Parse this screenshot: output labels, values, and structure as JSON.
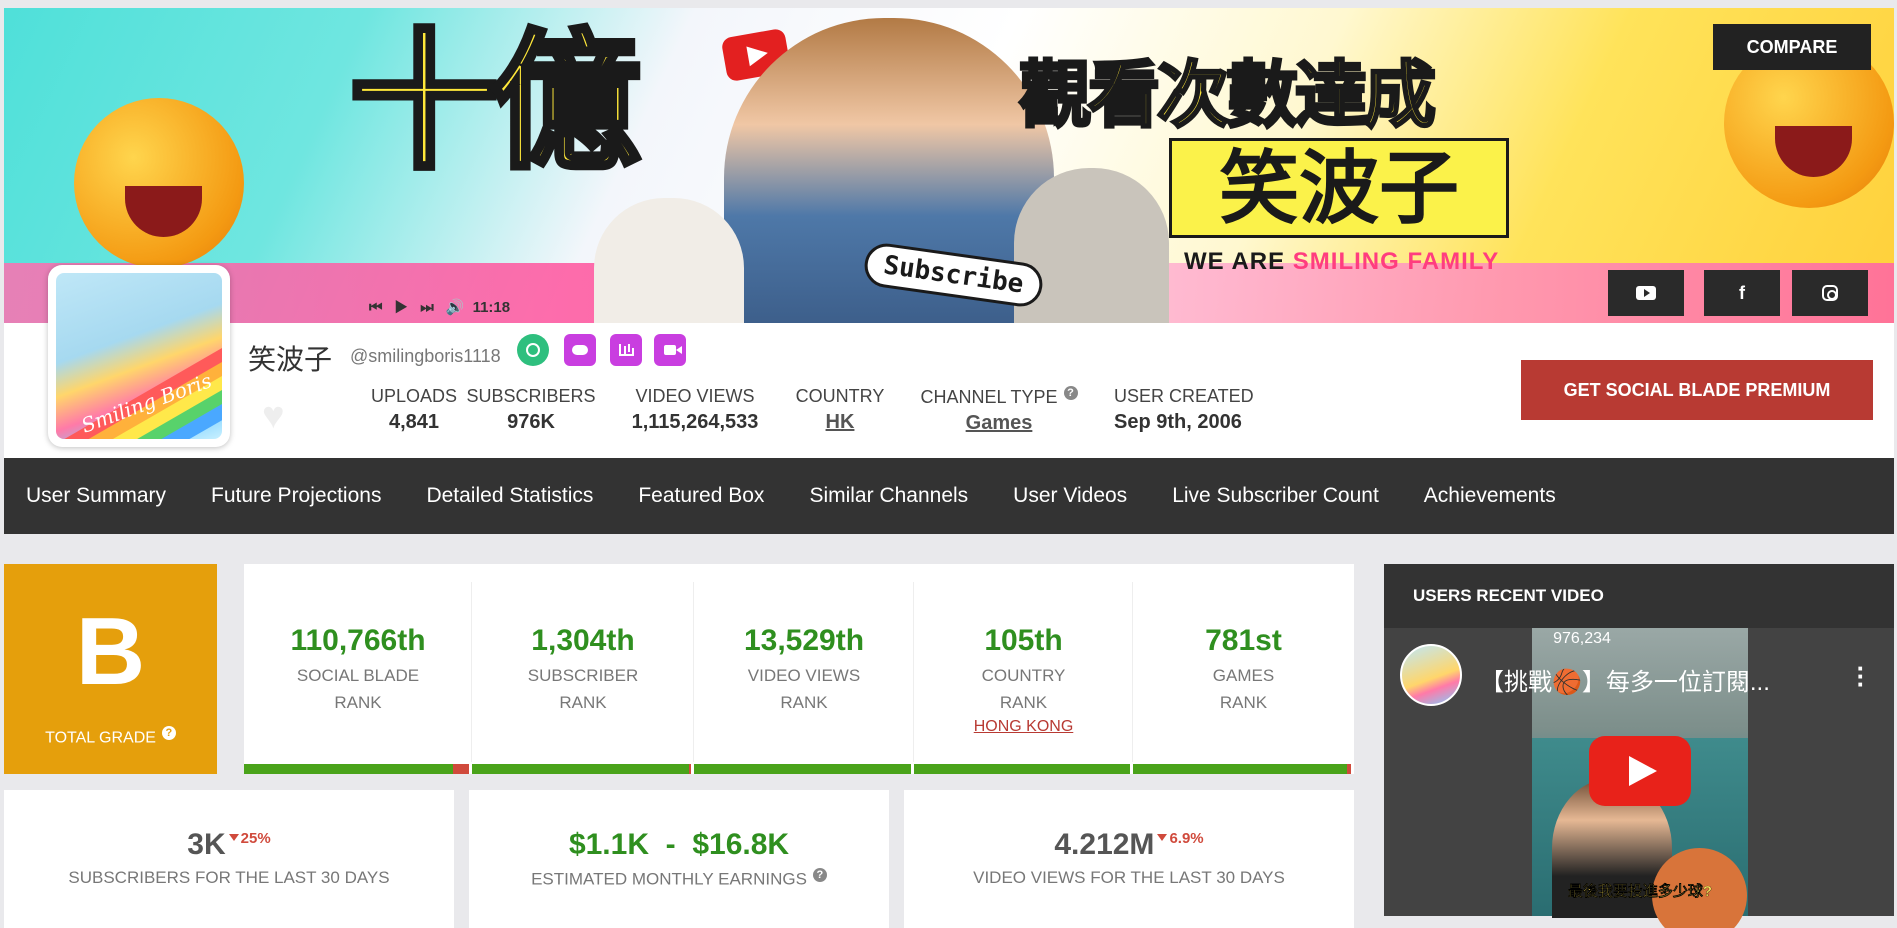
{
  "banner": {
    "headline": "十億",
    "subhead": "觀看次數達成",
    "name_art": "笑波子",
    "tagline_prefix": "WE ARE ",
    "tagline_highlight": "SMILING FAMILY",
    "subscribe_bubble": "Subscribe",
    "player_controls": "⏮ ▶ ⏭ 🔊",
    "player_time": "11:18",
    "avatar_art_text": "Smiling Boris"
  },
  "header": {
    "compare_label": "COMPARE",
    "social": {
      "youtube": "youtube-icon",
      "facebook": "f",
      "instagram": "instagram-icon"
    }
  },
  "channel": {
    "name": "笑波子",
    "handle": "@smilingboris1118",
    "badges": [
      "clock-icon",
      "cloud-upload-icon",
      "bar-chart-icon",
      "video-camera-icon"
    ],
    "colors": {
      "badge_green": "#2ebf7e",
      "badge_purple": "#c93ee0"
    }
  },
  "stats": {
    "uploads": {
      "label": "UPLOADS",
      "value": "4,841"
    },
    "subscribers": {
      "label": "SUBSCRIBERS",
      "value": "976K"
    },
    "video_views": {
      "label": "VIDEO VIEWS",
      "value": "1,115,264,533"
    },
    "country": {
      "label": "COUNTRY",
      "value": "HK"
    },
    "channel_type": {
      "label": "CHANNEL TYPE",
      "value": "Games",
      "help": "?"
    },
    "user_created": {
      "label": "USER CREATED",
      "value": "Sep 9th, 2006"
    }
  },
  "premium_label": "GET SOCIAL BLADE PREMIUM",
  "nav": [
    "User Summary",
    "Future Projections",
    "Detailed Statistics",
    "Featured Box",
    "Similar Channels",
    "User Videos",
    "Live Subscriber Count",
    "Achievements"
  ],
  "grade": {
    "letter": "B",
    "label": "TOTAL GRADE",
    "help": "?",
    "color": "#e59f0c"
  },
  "ranks": [
    {
      "value": "110,766th",
      "line1": "SOCIAL BLADE",
      "line2": "RANK",
      "bar_fill": 0.93
    },
    {
      "value": "1,304th",
      "line1": "SUBSCRIBER",
      "line2": "RANK",
      "bar_fill": 0.99
    },
    {
      "value": "13,529th",
      "line1": "VIDEO VIEWS",
      "line2": "RANK",
      "bar_fill": 1.0
    },
    {
      "value": "105th",
      "line1": "COUNTRY",
      "line2": "RANK",
      "link": "HONG KONG",
      "bar_fill": 1.0
    },
    {
      "value": "781st",
      "line1": "GAMES",
      "line2": "RANK",
      "bar_fill": 0.98
    }
  ],
  "summary": {
    "subs30": {
      "value": "3K",
      "delta": "25%",
      "label": "SUBSCRIBERS FOR THE LAST 30 DAYS"
    },
    "earnings": {
      "value": "$1.1K  -  $16.8K",
      "label": "ESTIMATED MONTHLY EARNINGS",
      "help": "?"
    },
    "views30": {
      "value": "4.212M",
      "delta": "6.9%",
      "label": "VIDEO VIEWS FOR THE LAST 30 DAYS"
    }
  },
  "recent_video": {
    "header": "USERS RECENT VIDEO",
    "view_count": "976,234",
    "title": "【挑戰🏀】每多一位訂閱...",
    "caption": "最後我要投進多少球?"
  }
}
